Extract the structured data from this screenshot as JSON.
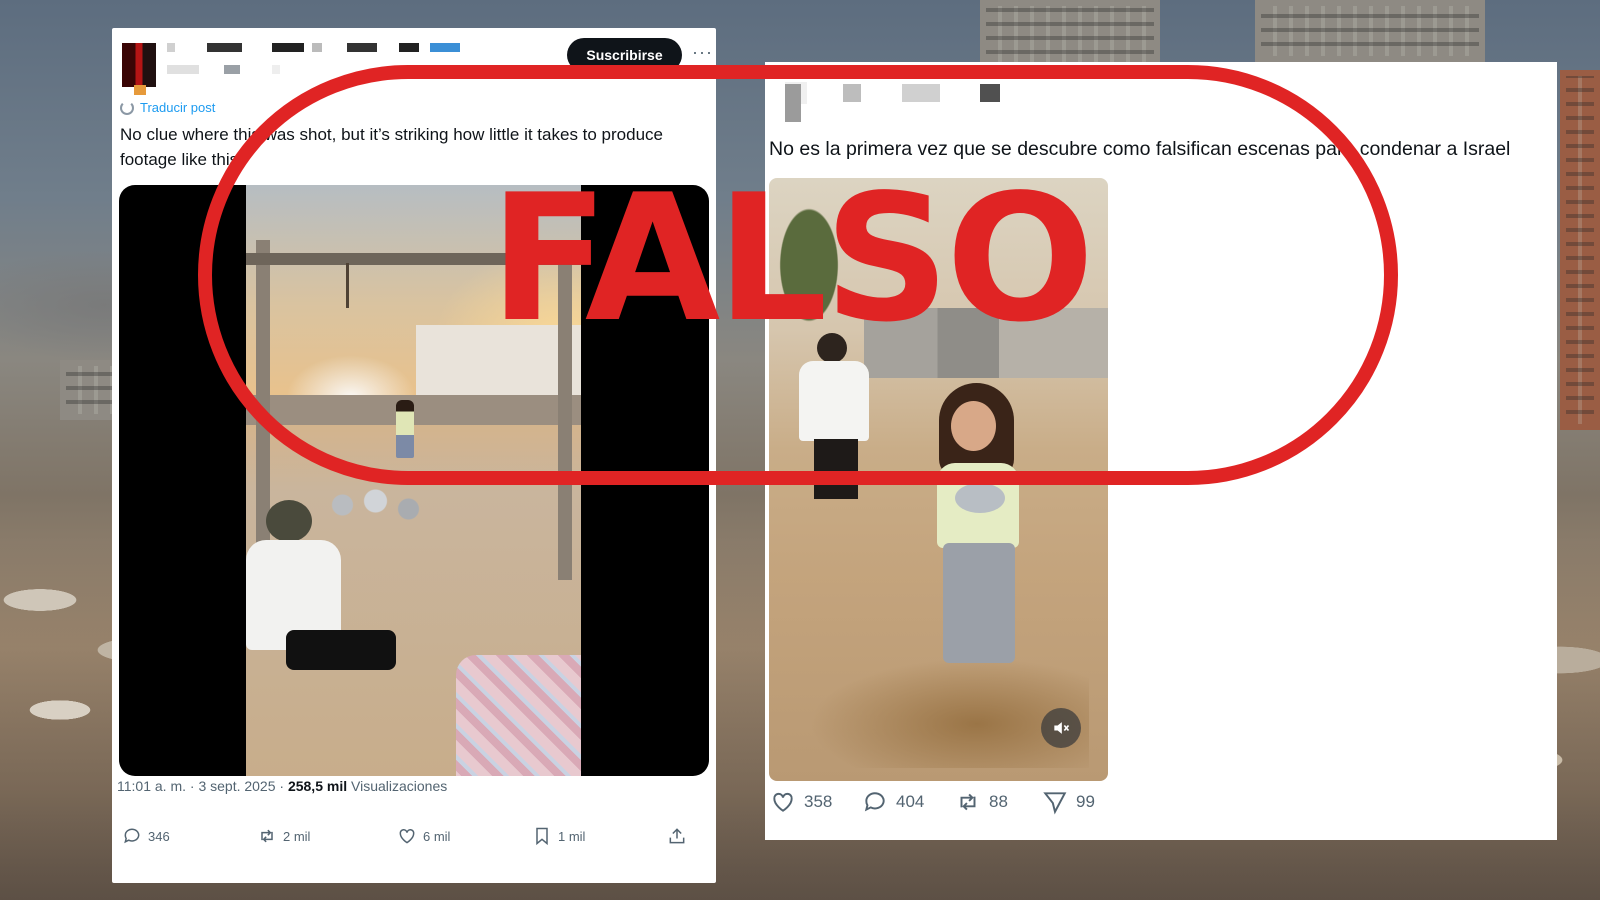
{
  "left_post": {
    "subscribe_label": "Suscribirse",
    "more_label": "···",
    "translate_label": "Traducir post",
    "text": "No clue where this was shot, but it’s striking how little it takes to produce footage like this.",
    "time": "11:01 a. m. · 3 sept. 2025 · ",
    "views_value": "258,5 mil",
    "views_label": " Visualizaciones",
    "replies": "346",
    "reposts": "2 mil",
    "likes": "6 mil",
    "bookmarks": "1 mil"
  },
  "right_post": {
    "text": "No es la primera vez que se descubre como falsifican escenas para condenar a Israel",
    "likes": "358",
    "replies": "404",
    "reposts": "88",
    "shares": "99"
  },
  "stamp": {
    "label": "FALSO",
    "color": "#e02424"
  },
  "colors": {
    "x_blue": "#1d9bf0",
    "text": "#0f1419",
    "muted": "#536471"
  }
}
